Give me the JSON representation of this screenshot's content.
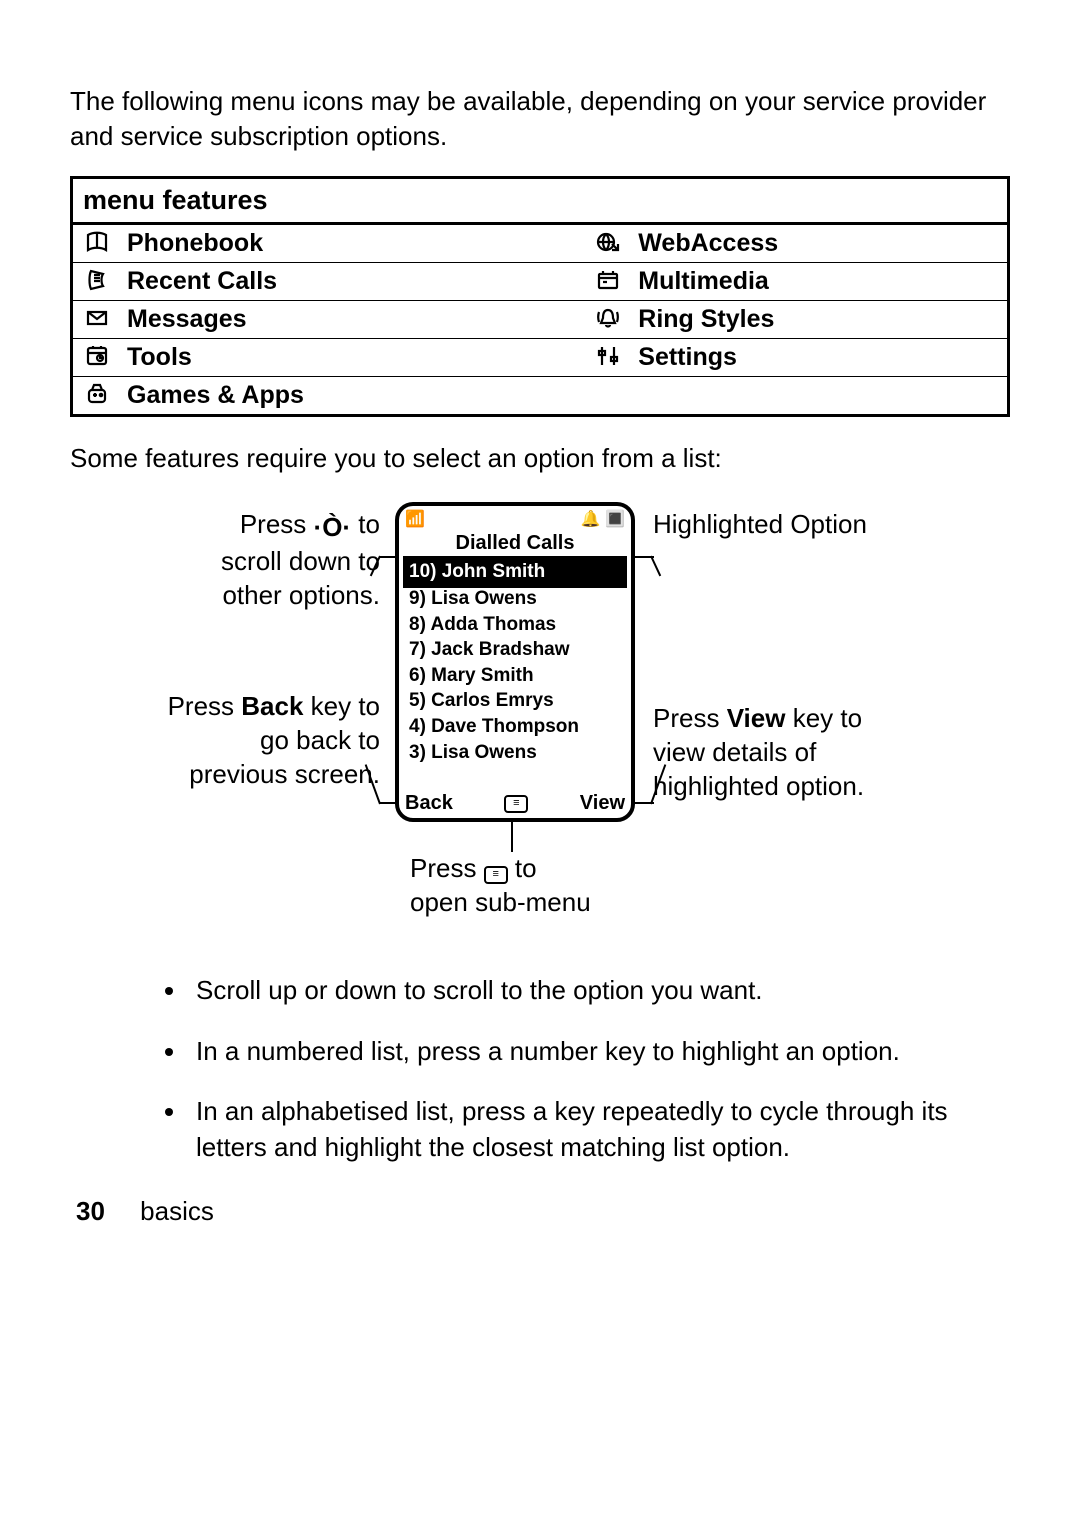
{
  "intro": "The following menu icons may be available, depending on your service provider and service subscription options.",
  "table_header": "menu features",
  "features": {
    "left": [
      {
        "icon": "phonebook-icon",
        "label": "Phonebook"
      },
      {
        "icon": "recent-calls-icon",
        "label": "Recent Calls"
      },
      {
        "icon": "messages-icon",
        "label": "Messages"
      },
      {
        "icon": "tools-icon",
        "label": "Tools"
      },
      {
        "icon": "games-icon",
        "label": "Games & Apps"
      }
    ],
    "right": [
      {
        "icon": "webaccess-icon",
        "label": "WebAccess"
      },
      {
        "icon": "multimedia-icon",
        "label": "Multimedia"
      },
      {
        "icon": "ringstyles-icon",
        "label": "Ring Styles"
      },
      {
        "icon": "settings-icon",
        "label": "Settings"
      },
      {
        "icon": "",
        "label": ""
      }
    ]
  },
  "mid": "Some features require you to select an option from a list:",
  "phone": {
    "status_left": "📶",
    "status_right": "🔔 🔳",
    "title": "Dialled Calls",
    "entries": [
      "10) John Smith",
      "9) Lisa Owens",
      "8) Adda Thomas",
      "7) Jack Bradshaw",
      "6) Mary Smith",
      "5) Carlos Emrys",
      "4) Dave Thompson",
      "3) Lisa Owens"
    ],
    "soft_left": "Back",
    "soft_menu": "≡",
    "soft_right": "View"
  },
  "callouts": {
    "scroll_a": "Press ",
    "scroll_b": " to",
    "scroll_c": "scroll down to other options.",
    "back_a": "Press ",
    "back_b": "Back",
    "back_c": " key to go back to previous screen.",
    "menu_a": "Press ",
    "menu_b": " to",
    "menu_c": "open sub-menu",
    "hl": "Highlighted Option",
    "view_a": "Press ",
    "view_b": "View",
    "view_c": " key to view details of highlighted option."
  },
  "bullets": [
    "Scroll up or down to scroll to the option you want.",
    "In a numbered list, press a number key to highlight an option.",
    "In an alphabetised list, press a key repeatedly to cycle through its letters and highlight the closest matching list option."
  ],
  "page_number": "30",
  "section": "basics"
}
